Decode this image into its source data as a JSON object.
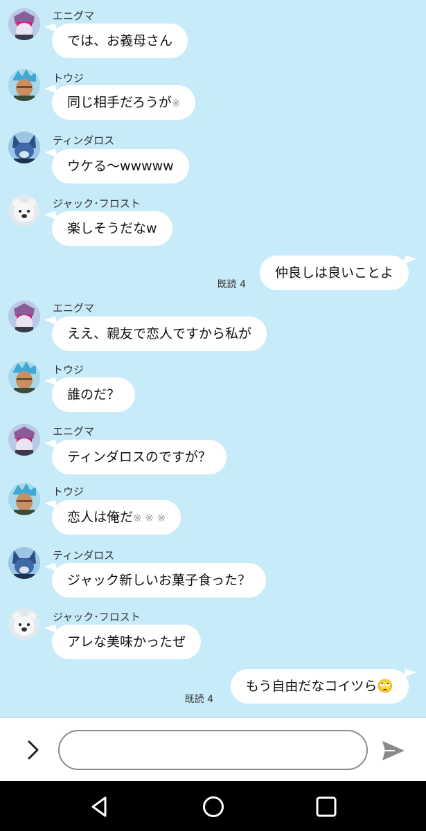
{
  "messages": [
    {
      "type": "in",
      "sender": "エニグマ",
      "avatar": "enigma",
      "text": "では、お義母さん"
    },
    {
      "type": "in",
      "sender": "トウジ",
      "avatar": "touji",
      "text": "同じ相手だろうが",
      "mark": "※"
    },
    {
      "type": "in",
      "sender": "ティンダロス",
      "avatar": "tindalos",
      "text": "ウケる〜wwwww"
    },
    {
      "type": "in",
      "sender": "ジャック･フロスト",
      "avatar": "jack",
      "text": "楽しそうだなw"
    },
    {
      "type": "out",
      "text": "仲良しは良いことよ",
      "read": "既読 4"
    },
    {
      "type": "in",
      "sender": "エニグマ",
      "avatar": "enigma",
      "text": "ええ、親友で恋人ですから私が"
    },
    {
      "type": "in",
      "sender": "トウジ",
      "avatar": "touji",
      "text": "誰のだ？"
    },
    {
      "type": "in",
      "sender": "エニグマ",
      "avatar": "enigma",
      "text": "ティンダロスのですが？"
    },
    {
      "type": "in",
      "sender": "トウジ",
      "avatar": "touji",
      "text": "恋人は俺だ",
      "mark": "※ ※ ※"
    },
    {
      "type": "in",
      "sender": "ティンダロス",
      "avatar": "tindalos",
      "text": "ジャック新しいお菓子食った？"
    },
    {
      "type": "in",
      "sender": "ジャック･フロスト",
      "avatar": "jack",
      "text": "アレな美味かったぜ"
    },
    {
      "type": "out",
      "text": "もう自由だなコイツら",
      "emoji": "🙄",
      "read": "既読 4"
    }
  ],
  "input": {
    "placeholder": "",
    "value": ""
  },
  "icons": {
    "expand": "chevron-right-icon",
    "send": "send-icon",
    "nav_back": "back-triangle-icon",
    "nav_home": "home-circle-icon",
    "nav_recents": "recents-square-icon"
  },
  "colors": {
    "background": "#c7ebf8",
    "bubble": "#ffffff",
    "input_bar": "#ffffff",
    "nav_bar": "#000000"
  }
}
